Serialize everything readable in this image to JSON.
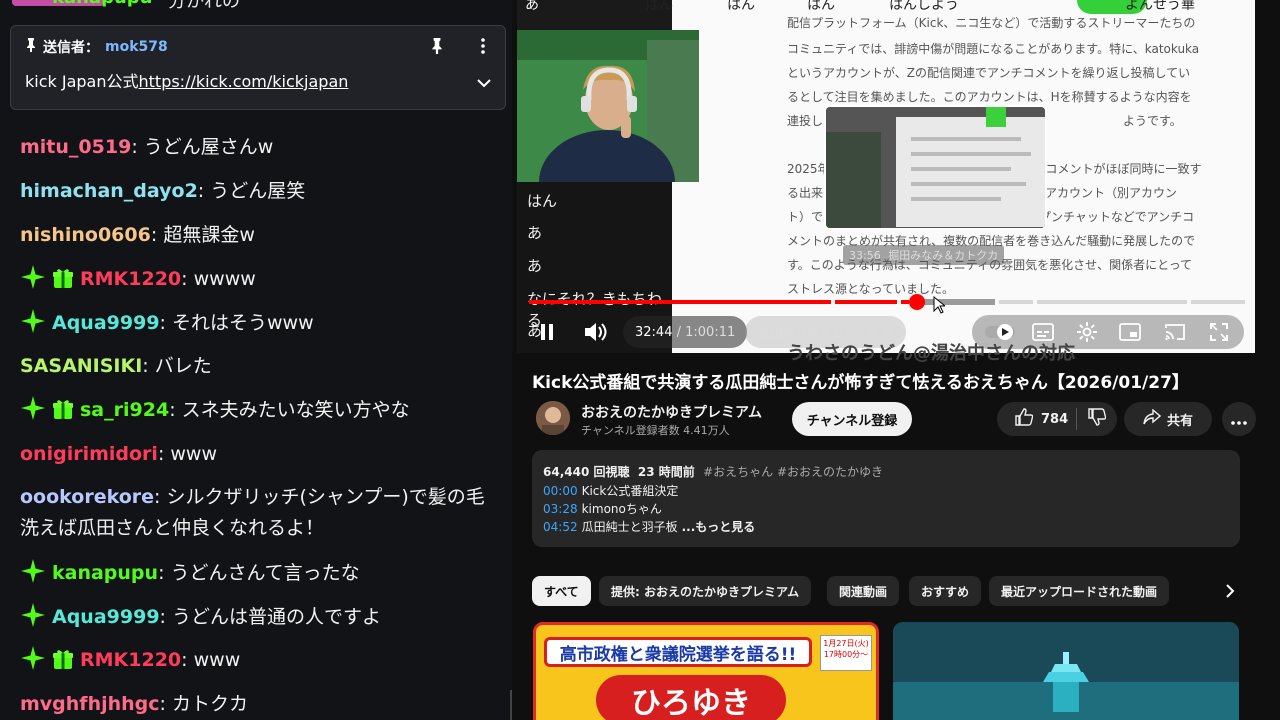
{
  "chat": {
    "top_partial": {
      "user": "kanapupu",
      "text": "分かれの"
    },
    "pinned": {
      "label": "送信者：",
      "sender": "mok578",
      "message_prefix": "kick Japan公式",
      "link": "https://kick.com/kickjapan",
      "pin_icon": "pin-icon",
      "menu_icon": "more-vertical-icon",
      "expand_icon": "chevron-down-icon"
    },
    "messages": [
      {
        "user": "mitu_0519",
        "color": "#ff6b8a",
        "text": "うどん屋さんw",
        "sparkle": false,
        "sub": false
      },
      {
        "user": "himachan_dayo2",
        "color": "#8fe3f0",
        "text": "うどん屋笑",
        "sparkle": false,
        "sub": false
      },
      {
        "user": "nishino0606",
        "color": "#f6c58a",
        "text": "超無課金w",
        "sparkle": false,
        "sub": false
      },
      {
        "user": "RMK1220",
        "color": "#ff3c5a",
        "text": "wwww",
        "sparkle": true,
        "sub": true
      },
      {
        "user": "Aqua9999",
        "color": "#56e8d8",
        "text": "それはそうwww",
        "sparkle": true,
        "sub": false
      },
      {
        "user": "SASANISIKI",
        "color": "#b8f56b",
        "text": "バレた",
        "sparkle": false,
        "sub": false
      },
      {
        "user": "sa_ri924",
        "color": "#53fc18",
        "text": "スネ夫みたいな笑い方やな",
        "sparkle": true,
        "sub": true
      },
      {
        "user": "onigirimidori",
        "color": "#ff3c5a",
        "text": "www",
        "sparkle": false,
        "sub": false
      },
      {
        "user": "oookorekore",
        "color": "#b8c8ff",
        "text": "シルクザリッチ(シャンプー)で髪の毛洗えば瓜田さんと仲良くなれるよ！",
        "sparkle": false,
        "sub": false
      },
      {
        "user": "kanapupu",
        "color": "#53fc18",
        "text": "うどんさんて言ったな",
        "sparkle": true,
        "sub": false
      },
      {
        "user": "Aqua9999",
        "color": "#56e8d8",
        "text": "うどんは普通の人ですよ",
        "sparkle": true,
        "sub": false
      },
      {
        "user": "RMK1220",
        "color": "#ff3c5a",
        "text": "www",
        "sparkle": true,
        "sub": true
      },
      {
        "user": "mvghfhjhhgc",
        "color": "#ff6b8a",
        "text": "カトクカ",
        "sparkle": false,
        "sub": false
      }
    ]
  },
  "video": {
    "top_overlay": [
      "あ",
      "はん",
      "はん",
      "はん",
      "はんしよう",
      "よんせう華"
    ],
    "doc_lines": [
      "配信プラットフォーム（Kick、ニコ生など）で活動するストリーマーたちの",
      "コミュニティでは、誹謗中傷が問題になることがあります。特に、katokuka",
      "というアカウントが、Zの配信関連でアンチコメントを繰り返し投稿してい",
      "るとして注目を集めました。このアカウントは、Hを称賛するような内容を",
      "連投し　　　　　　　　　　　　　　　　　　　　　　　　　ようです。",
      "2025年　　　　　　　　　　　　　　　　　　コメントがほぼ同時に一致す",
      "る出来　　　　　　　　　　　　　　　　　　「アカウント（別アカウン",
      "ト）で　　　　　　　　　　　　　　　　　　プンチャットなどでアンチコ",
      "メントのまとめが共有され、複数の配信者を巻き込んだ騒動に発展したので",
      "す。このような行為は、コミュニティの雰囲気を悪化させ、関係者にとって",
      "ストレス源となっていました。"
    ],
    "doc_heading": "うわさのうどん@湯治中さんの対応",
    "side_lines": [
      "はん",
      "あ",
      "あ",
      "なにそれ？きもちわる",
      "あ"
    ],
    "preview_time": "33:56",
    "preview_chapter": "掘田みなみ＆カトクカ",
    "current_time": "32:44",
    "duration": "1:00:11",
    "time_sep": " / ",
    "chapter_label": "掘田みなみ＆カトクカ",
    "progress_fraction": 0.544,
    "icons": [
      "pause-icon",
      "volume-icon",
      "autoplay-toggle",
      "captions-icon",
      "settings-icon",
      "miniplayer-icon",
      "cast-icon",
      "fullscreen-icon"
    ]
  },
  "details": {
    "title": "Kick公式番組で共演する瓜田純士さんが怖すぎて怯えるおえちゃん【2026/01/27】",
    "channel": "おおえのたかゆきプレミアム",
    "subscribers": "チャンネル登録者数 4.41万人",
    "subscribe_label": "チャンネル登録",
    "likes": "784",
    "share_label": "共有",
    "views": "64,440 回視聴",
    "age": "23 時間前",
    "hashtags": "#おえちゃん #おおえのたかゆき",
    "chapters": [
      {
        "ts": "00:00",
        "title": "Kick公式番組決定"
      },
      {
        "ts": "03:28",
        "title": "kimonoちゃん"
      },
      {
        "ts": "04:52",
        "title": "瓜田純士と羽子板"
      }
    ],
    "more_label": "...もっと見る"
  },
  "chips": [
    "すべて",
    "提供: おおえのたかゆきプレミアム",
    "関連動画",
    "おすすめ",
    "最近アップロードされた動画"
  ],
  "thumb1": {
    "banner": "高市政権と衆議院選挙を語る!!",
    "date": "1月27日(火) 17時00分～",
    "name": "ひろゆき"
  }
}
